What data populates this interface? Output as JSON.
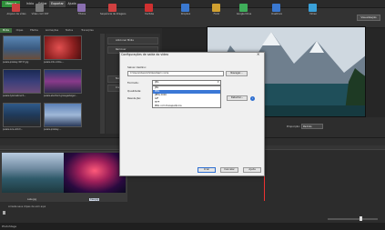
{
  "menubar": {
    "menu_button": "Menu ▾",
    "items": [
      "Início",
      "Editar",
      "Exportar",
      "Ajuda"
    ]
  },
  "toolbar": {
    "tools": [
      {
        "label": "Arquivo de vídeo",
        "icon": "video-file-icon",
        "color": "#c94040"
      },
      {
        "label": "Vídeo com VST",
        "icon": "video-vst-icon",
        "color": "#7a7a7a"
      },
      {
        "label": "Títulos",
        "icon": "titles-icon",
        "color": "#8a6fb0"
      },
      {
        "label": "Sequência de Imagens",
        "icon": "image-sequence-icon",
        "color": "#d04040"
      },
      {
        "label": "YouTube",
        "icon": "youtube-icon",
        "color": "#d03030"
      },
      {
        "label": "Dropbox",
        "icon": "dropbox-icon",
        "color": "#3a78d0"
      },
      {
        "label": "Flickr",
        "icon": "flickr-icon",
        "color": "#d0a030"
      },
      {
        "label": "Google Drive",
        "icon": "google-drive-icon",
        "color": "#3fae5a"
      },
      {
        "label": "OneDrive",
        "icon": "onedrive-icon",
        "color": "#3a78d0"
      },
      {
        "label": "Vimeo",
        "icon": "vimeo-icon",
        "color": "#3aa0d8"
      }
    ],
    "viz_button": "Visualização"
  },
  "tabs": [
    "Mídia",
    "Clipes",
    "Efeitos",
    "Animações",
    "Textos",
    "Transições"
  ],
  "media": [
    {
      "caption": "pexels-pixabay-36717.jpg"
    },
    {
      "caption": "pexels-mili-collins-..."
    },
    {
      "caption": "pexels-tyler-lastovich..."
    },
    {
      "caption": "pexels-eberhard-grossgasteiger..."
    },
    {
      "caption": "pexels-luca-ullrich..."
    },
    {
      "caption": "pexels-pixabay-..."
    }
  ],
  "side_actions": [
    "Adicionar Mídia",
    "Remover",
    "Nome",
    "Crescente"
  ],
  "preview": {
    "proj_label": "Proporção:",
    "proj_value": "Padrão"
  },
  "timeline": {
    "clips": [
      {
        "caption": "Lake.jpg"
      },
      {
        "caption": "tree.jpg"
      }
    ],
    "drop_hint": "Arraste seus clipes de som aqui",
    "status": "PhotoStage"
  },
  "dialog": {
    "title": "Configurações de saída do vídeo",
    "close": "✕",
    "save_label": "Salvar destino:",
    "path": "C:\\Users\\Usuário\\Videos\\Sem nome",
    "browse": "Navegar...",
    "format_label": "Formato:",
    "format_value": "JPG",
    "quality_label": "Qualidade:",
    "resolution_label": "Resolução:",
    "format_options": [
      "JPG",
      "PNG",
      "JPEG 2000",
      "GIF",
      "TIFF",
      "PNG com transparência"
    ],
    "selected_index": 1,
    "detect": "Detectar...",
    "ok": "Criar",
    "cancel": "Cancelar",
    "help": "Ajuda"
  }
}
